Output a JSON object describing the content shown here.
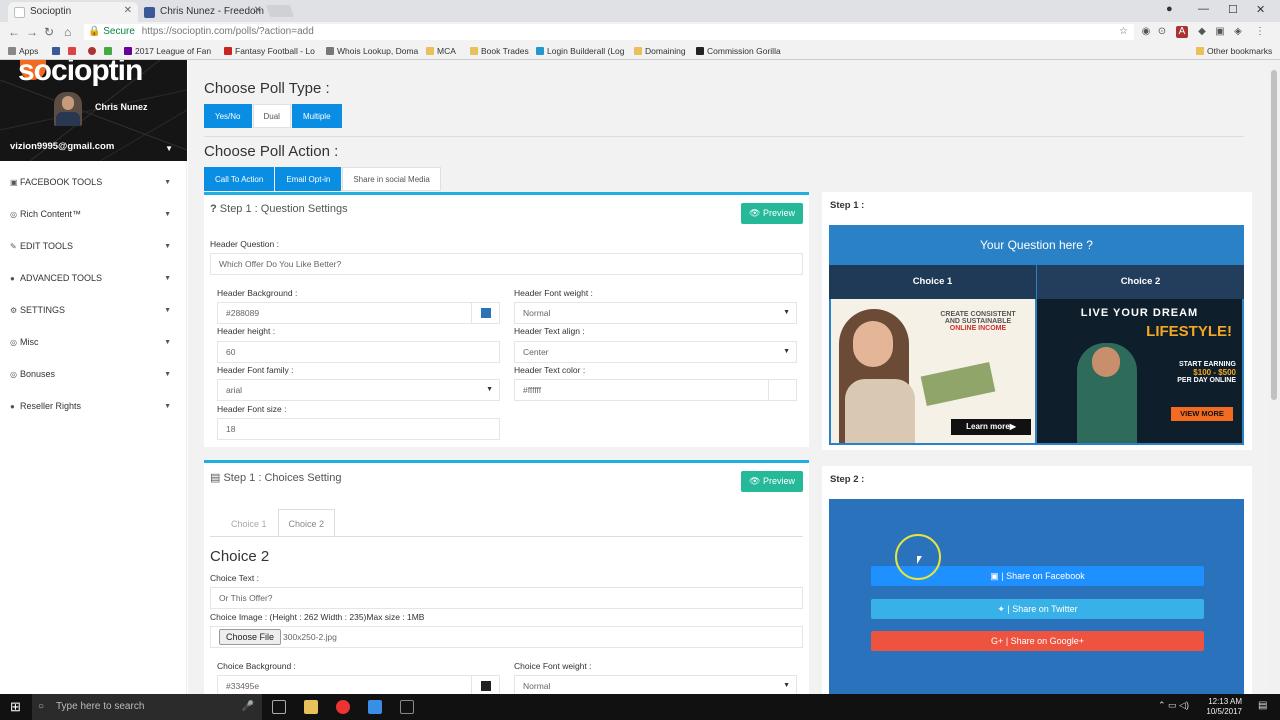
{
  "browser": {
    "tabs": [
      {
        "label": "Socioptin"
      },
      {
        "label": "Chris Nunez - Freedom"
      }
    ],
    "address": {
      "secure_label": "Secure",
      "url": "https://socioptin.com/polls/?action=add"
    },
    "bookmarks": [
      "Apps",
      "2017 League of Fan",
      "Fantasy Football - Lo",
      "Whois Lookup, Doma",
      "MCA",
      "Book Trades",
      "Login Builderall (Log",
      "Domaining",
      "Commission Gorilla",
      "Other bookmarks"
    ]
  },
  "sidebar": {
    "logo": "socioptin",
    "profile_name": "Chris Nunez",
    "email": "vizion9995@gmail.com",
    "items": [
      {
        "label": "FACEBOOK TOOLS"
      },
      {
        "label": "Rich Content™"
      },
      {
        "label": "EDIT TOOLS"
      },
      {
        "label": "ADVANCED TOOLS"
      },
      {
        "label": "SETTINGS"
      },
      {
        "label": "Misc"
      },
      {
        "label": "Bonuses"
      },
      {
        "label": "Reseller Rights"
      }
    ]
  },
  "poll_type": {
    "heading": "Choose Poll Type :",
    "options": [
      {
        "label": "Yes/No"
      },
      {
        "label": "Dual"
      },
      {
        "label": "Multiple"
      }
    ]
  },
  "poll_action": {
    "heading": "Choose Poll Action :",
    "options": [
      {
        "label": "Call To Action"
      },
      {
        "label": "Email Opt-in"
      },
      {
        "label": "Share in social Media"
      }
    ]
  },
  "question_settings": {
    "title": "Step 1 : Question Settings",
    "preview_label": "Preview",
    "header_question_label": "Header Question :",
    "header_question_value": "Which Offer Do You Like Better?",
    "header_background_label": "Header Background :",
    "header_background_value": "#288089",
    "header_font_weight_label": "Header Font weight :",
    "header_font_weight_value": "Normal",
    "header_height_label": "Header height :",
    "header_height_value": "60",
    "header_text_align_label": "Header Text align :",
    "header_text_align_value": "Center",
    "header_font_family_label": "Header Font family :",
    "header_font_family_value": "arial",
    "header_text_color_label": "Header Text color :",
    "header_text_color_value": "#ffffff",
    "header_font_size_label": "Header Font size :",
    "header_font_size_value": "18"
  },
  "choices_setting": {
    "title": "Step 1 : Choices Setting",
    "preview_label": "Preview",
    "tabs": [
      {
        "label": "Choice 1"
      },
      {
        "label": "Choice 2"
      }
    ],
    "heading": "Choice 2",
    "choice_text_label": "Choice Text :",
    "choice_text_value": "Or This Offer?",
    "choice_image_label": "Choice Image : (Height : 262 Width : 235)Max size : 1MB",
    "choose_file_label": "Choose File",
    "file_name": "300x250-2.jpg",
    "choice_background_label": "Choice Background :",
    "choice_background_value": "#33495e",
    "choice_font_weight_label": "Choice Font weight :",
    "choice_font_weight_value": "Normal"
  },
  "step1_preview": {
    "title": "Step 1 :",
    "question": "Your Question here ?",
    "choice1": "Choice 1",
    "choice2": "Choice 2",
    "ad1": {
      "line1": "CREATE CONSISTENT",
      "line2": "AND SUSTAINABLE",
      "line3": "ONLINE INCOME",
      "cta": "Learn more▶"
    },
    "ad2": {
      "line1": "LIVE YOUR DREAM",
      "line2": "LIFESTYLE!",
      "line3": "START EARNING",
      "line4": "$100 - $500",
      "line5": "PER DAY ONLINE",
      "cta": "VIEW MORE"
    }
  },
  "step2_preview": {
    "title": "Step 2 :",
    "facebook": "| Share on Facebook",
    "twitter": "| Share on Twitter",
    "google": "| Share on Google+"
  },
  "taskbar": {
    "search_placeholder": "Type here to search",
    "time": "12:13 AM",
    "date": "10/5/2017"
  },
  "colors": {
    "accent_blue": "#0a8ee4",
    "preview_green": "#25b99a",
    "header_bg": "#2b81c5",
    "choice_bar": "#1f3a57",
    "facebook": "#1e90ff",
    "twitter": "#38b0e8",
    "google": "#ee5340"
  }
}
